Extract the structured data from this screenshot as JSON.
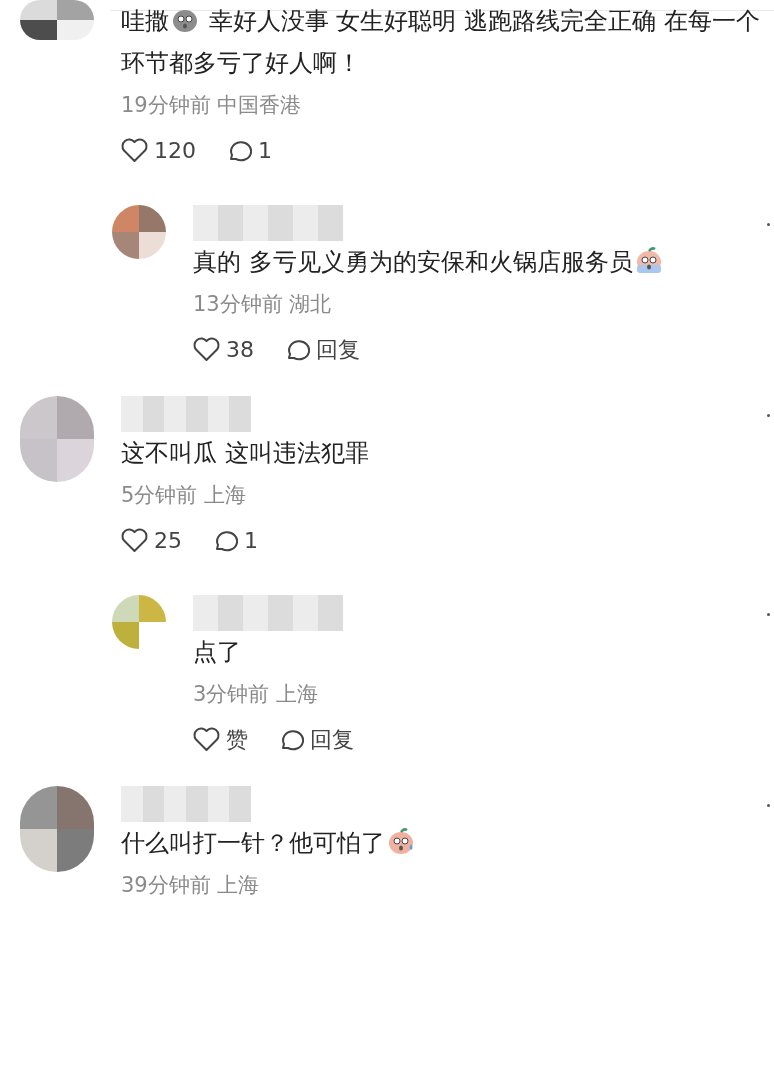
{
  "comments": [
    {
      "parts": [
        {
          "kind": "text",
          "text": "哇撒"
        },
        {
          "kind": "sackface"
        },
        {
          "kind": "text",
          "text": " 幸好人没事 女生好聪明 逃跑路线完全正确 在每一个环节都多亏了好人啊！"
        }
      ],
      "meta": "19分钟前 中国香港",
      "likes": "120",
      "replies_label": "1",
      "replies": [
        {
          "parts": [
            {
              "kind": "text",
              "text": "真的 多亏见义勇为的安保和火锅店服务员"
            },
            {
              "kind": "crying"
            }
          ],
          "meta": "13分钟前 湖北",
          "likes": "38",
          "replies_label": "回复"
        }
      ]
    },
    {
      "parts": [
        {
          "kind": "text",
          "text": "这不叫瓜 这叫违法犯罪"
        }
      ],
      "meta": "5分钟前 上海",
      "likes": "25",
      "replies_label": "1",
      "replies": [
        {
          "parts": [
            {
              "kind": "text",
              "text": "点了"
            }
          ],
          "meta": "3分钟前 上海",
          "likes": "赞",
          "replies_label": "回复"
        }
      ]
    },
    {
      "parts": [
        {
          "kind": "text",
          "text": "什么叫打一针？他可怕了"
        },
        {
          "kind": "sweating"
        }
      ],
      "meta": "39分钟前 上海"
    }
  ]
}
